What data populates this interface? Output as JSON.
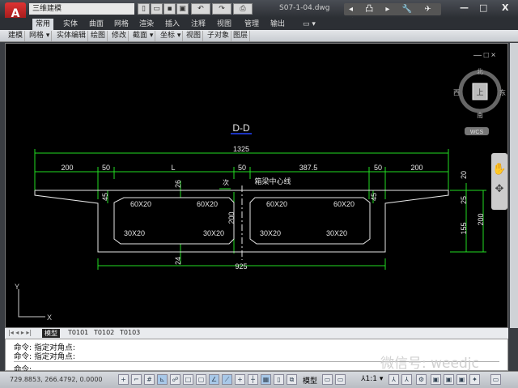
{
  "title_bar": {
    "app_icon": "A",
    "workspace": "三维建模",
    "document": "S07-1-04.dwg",
    "tools": "◂ 凸 ▸ 🔧 ✈ ★ ?",
    "win_buttons": [
      "—",
      "□",
      "X"
    ],
    "quick_access": [
      "new-icon",
      "open-icon",
      "save-icon",
      "saveas-icon",
      "undo-icon",
      "redo-icon",
      "plot-icon"
    ]
  },
  "ribbon_tabs": [
    "常用",
    "实体",
    "曲面",
    "网格",
    "渲染",
    "插入",
    "注释",
    "视图",
    "管理",
    "输出",
    "▭ ▾"
  ],
  "panels": [
    "建模",
    "网格 ▾",
    "实体编辑",
    "绘图",
    "修改",
    "截面 ▾",
    "坐标 ▾",
    "视图",
    "子对象",
    "图层"
  ],
  "viewport_controls": "— □ ×",
  "viewcube": {
    "north": "北",
    "south": "南",
    "west": "西",
    "east": "东",
    "top": "上",
    "wcs": "WCS"
  },
  "drawing": {
    "title": "D-D",
    "overall": "1325",
    "top_dims": [
      "200",
      "50",
      "L",
      "50",
      "387.5",
      "50",
      "200"
    ],
    "centerline_label": "箱梁中心线",
    "small_label": "次",
    "chamfers_top": [
      "60X20",
      "60X20",
      "60X20",
      "60X20"
    ],
    "chamfers_bottom": [
      "30X20",
      "30X20",
      "30X20",
      "30X20"
    ],
    "left_dims": {
      "haunch": "45",
      "top_slab": "26",
      "bottom_slab": "24",
      "height": "200"
    },
    "right_dims": {
      "a": "20",
      "b": "25",
      "c": "155",
      "total": "200",
      "haunch": "45"
    },
    "bottom_dim": "925",
    "ucs": {
      "x": "X",
      "y": "Y"
    }
  },
  "layout_tabs": {
    "nav": "|◂ ◂ ▸ ▸|",
    "tabs": [
      "模型",
      "T0101",
      "T0102",
      "T0103"
    ]
  },
  "command": {
    "history": [
      "命令: 指定对角点:",
      "命令: 指定对角点:"
    ],
    "prompt": "命令:"
  },
  "status": {
    "coords": "729.8853, 266.4792, 0.0000",
    "model": "模型",
    "scale": "⅄1:1 ▾"
  },
  "watermark": "微信号: weedjc",
  "colors": {
    "dim": "#22dd22",
    "geometry": "#e6e6e6",
    "title_underline": "#2244ff"
  }
}
